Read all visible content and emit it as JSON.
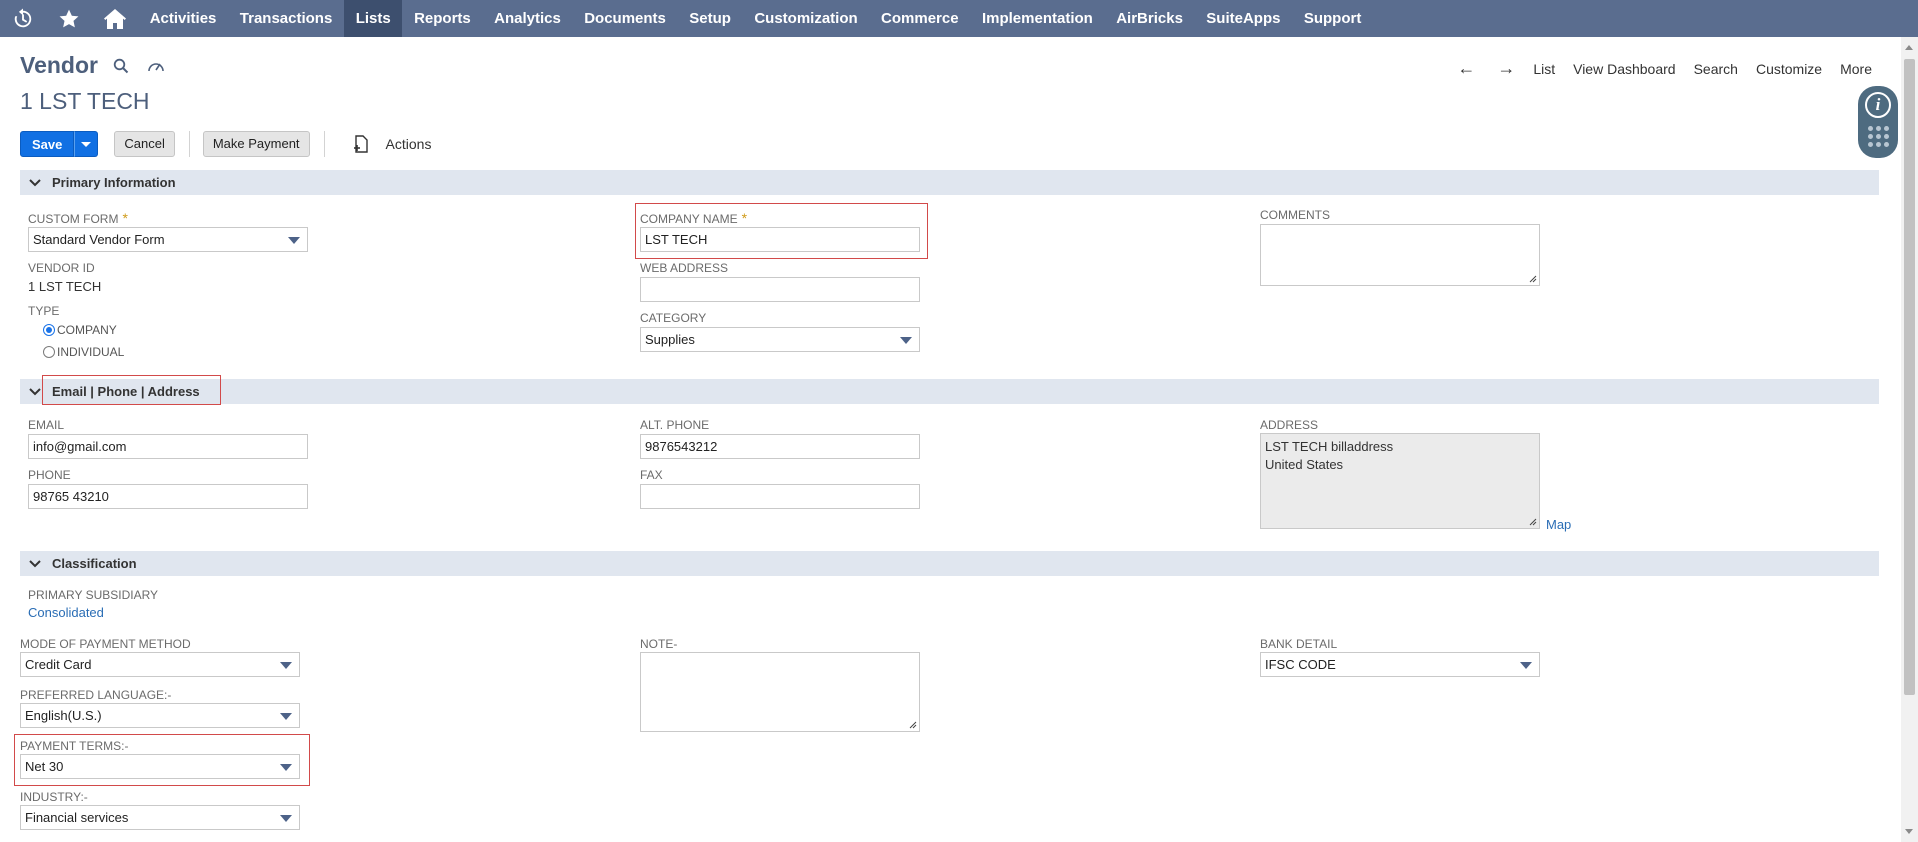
{
  "nav": {
    "icons": [
      "recent-icon",
      "star-icon",
      "home-icon"
    ],
    "items": [
      "Activities",
      "Transactions",
      "Lists",
      "Reports",
      "Analytics",
      "Documents",
      "Setup",
      "Customization",
      "Commerce",
      "Implementation",
      "AirBricks",
      "SuiteApps",
      "Support"
    ],
    "active": "Lists"
  },
  "header": {
    "record_type": "Vendor",
    "record_title": "1 LST TECH",
    "right_nav": {
      "list": "List",
      "view_dashboard": "View Dashboard",
      "search": "Search",
      "customize": "Customize",
      "more": "More"
    }
  },
  "buttons": {
    "save": "Save",
    "cancel": "Cancel",
    "make_payment": "Make Payment",
    "actions": "Actions"
  },
  "sections": {
    "primary": "Primary Information",
    "contact": "Email | Phone | Address",
    "classification": "Classification"
  },
  "primary": {
    "custom_form_label": "CUSTOM FORM",
    "custom_form_value": "Standard Vendor Form",
    "vendor_id_label": "VENDOR ID",
    "vendor_id_value": "1 LST TECH",
    "type_label": "TYPE",
    "type_company": "COMPANY",
    "type_individual": "INDIVIDUAL",
    "company_name_label": "COMPANY NAME",
    "company_name_value": "LST TECH",
    "web_address_label": "WEB ADDRESS",
    "web_address_value": "",
    "category_label": "CATEGORY",
    "category_value": "Supplies",
    "comments_label": "COMMENTS",
    "comments_value": ""
  },
  "contact": {
    "email_label": "EMAIL",
    "email_value": "info@gmail.com",
    "phone_label": "PHONE",
    "phone_value": "98765 43210",
    "alt_phone_label": "ALT. PHONE",
    "alt_phone_value": "9876543212",
    "fax_label": "FAX",
    "fax_value": "",
    "address_label": "ADDRESS",
    "address_value": "LST TECH billaddress\nUnited States",
    "map_link": "Map"
  },
  "classification": {
    "primary_subsidiary_label": "PRIMARY SUBSIDIARY",
    "primary_subsidiary_value": "Consolidated",
    "mode_of_payment_label": "MODE OF PAYMENT METHOD",
    "mode_of_payment_value": "Credit Card",
    "preferred_language_label": "PREFERRED LANGUAGE:-",
    "preferred_language_value": "English(U.S.)",
    "payment_terms_label": "PAYMENT TERMS:-",
    "payment_terms_value": "Net 30",
    "industry_label": "INDUSTRY:-",
    "industry_value": "Financial services",
    "note_label": "NOTE-",
    "note_value": "",
    "bank_detail_label": "BANK DETAIL",
    "bank_detail_value": "IFSC CODE"
  },
  "colors": {
    "nav_bg": "#5a6d8f",
    "nav_active": "#3d4f6e",
    "save_blue": "#1170e3",
    "section_bg": "#e0e6ef",
    "highlight_red": "#d24a4a",
    "required_star": "#d09b1a"
  }
}
